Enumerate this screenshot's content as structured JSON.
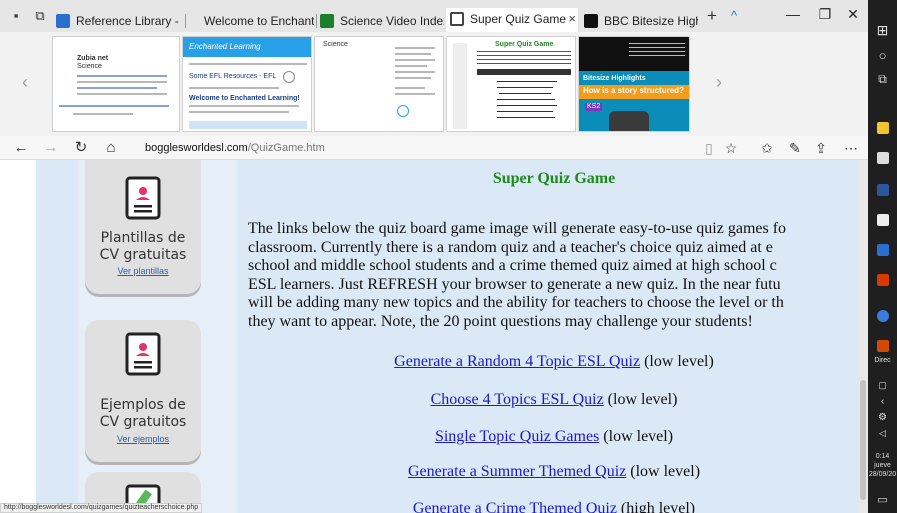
{
  "tabs": [
    {
      "label": "Reference Library - Science",
      "active": false
    },
    {
      "label": "Welcome to Enchanted Lear",
      "active": false
    },
    {
      "label": "Science Video Index",
      "active": false
    },
    {
      "label": "Super Quiz Game",
      "active": true
    },
    {
      "label": "BBC Bitesize Highlights",
      "active": false
    }
  ],
  "tab_controls": {
    "new_tab": "+",
    "tab_list": "^",
    "close": "×"
  },
  "window_controls": {
    "minimize": "—",
    "restore": "❐",
    "close": "✕"
  },
  "previews": {
    "thumb1": {
      "line1": "Zubia net",
      "line2": "Science"
    },
    "thumb2": {
      "brand": "Enchanted Learning",
      "line1": "Some EFL Resources - EFL",
      "line2": "Welcome to Enchanted Learning!"
    },
    "thumb3": {
      "line1": "Science"
    },
    "thumb4": {
      "line1": "Super Quiz Game"
    },
    "thumb5": {
      "banner1": "Bitesize Highlights",
      "banner2": "How is a story structured?",
      "tag": "KS2"
    }
  },
  "address_bar": {
    "domain": "bogglesworldesl.com",
    "path": "/QuizGame.htm"
  },
  "sidebar": {
    "cards": [
      {
        "title_line1": "Plantillas de",
        "title_line2": "CV gratuitas",
        "link": "Ver plantillas"
      },
      {
        "title_line1": "Ejemplos de",
        "title_line2": "CV gratuitos",
        "link": "Ver ejemplos"
      }
    ]
  },
  "main": {
    "title": "Super Quiz Game",
    "intro_lines": [
      "The links below the quiz board game image will generate easy-to-use quiz games fo",
      "classroom. Currently there is a random quiz and a teacher's choice quiz aimed at e",
      "school and middle school students and a crime themed quiz aimed at high school c",
      "ESL learners. Just REFRESH your browser to generate a new quiz. In the near futu",
      "will be adding many new topics and the ability for teachers to choose the level or th",
      "they want to appear. Note, the 20 point questions may challenge your students!"
    ],
    "quiz_links": [
      {
        "link": "Generate a Random 4 Topic ESL Quiz",
        "level": " (low level)"
      },
      {
        "link": "Choose 4 Topics ESL Quiz",
        "level": " (low level)"
      },
      {
        "link": "Single Topic Quiz Games",
        "level": " (low level)"
      },
      {
        "link": "Generate a Summer Themed Quiz",
        "level": " (low level)"
      },
      {
        "link": "Generate a Crime Themed Quiz",
        "level": " (high level)"
      }
    ]
  },
  "status_bar": {
    "url": "http://bogglesworldesl.com/quizgames/quizteacherschoice.php"
  },
  "taskbar": {
    "label_direc": "Direc",
    "clock_time": "0:14",
    "clock_day": "jueve",
    "clock_date": "28/09/20"
  },
  "colors": {
    "title_green": "#1e8a1e",
    "link_blue": "#1a1acc",
    "content_bg": "#dbe9f7",
    "tabbar_bg": "#e6e6e6"
  }
}
